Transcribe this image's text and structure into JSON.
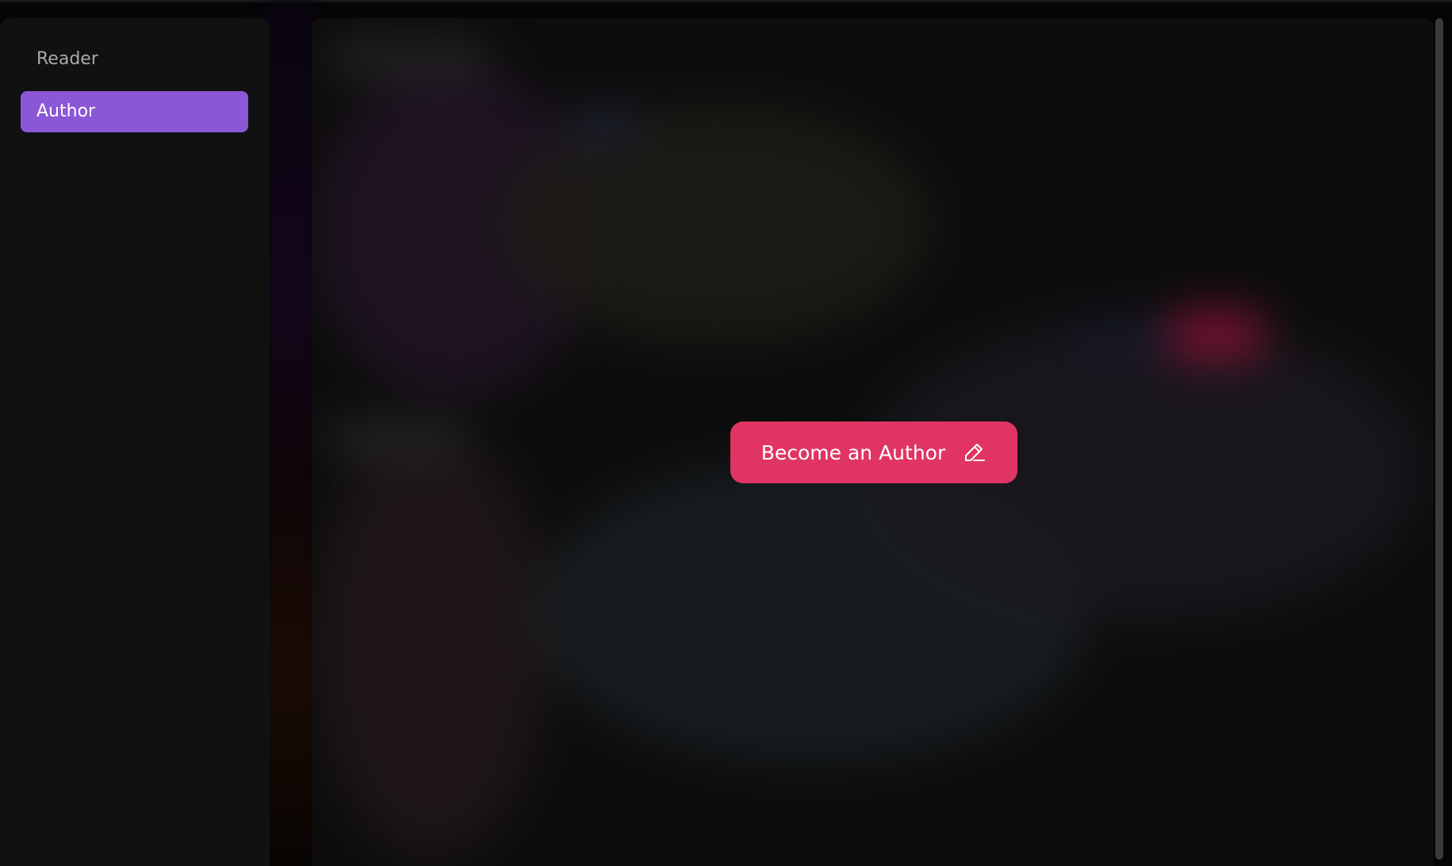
{
  "sidebar": {
    "items": [
      {
        "label": "Reader",
        "active": false
      },
      {
        "label": "Author",
        "active": true
      }
    ]
  },
  "main": {
    "cta": {
      "label": "Become an Author",
      "icon": "pencil-icon"
    }
  },
  "colors": {
    "accent_purple": "#8c57d6",
    "cta_pink": "#e03564",
    "background": "#050505",
    "sidebar_bg": "#111111"
  }
}
